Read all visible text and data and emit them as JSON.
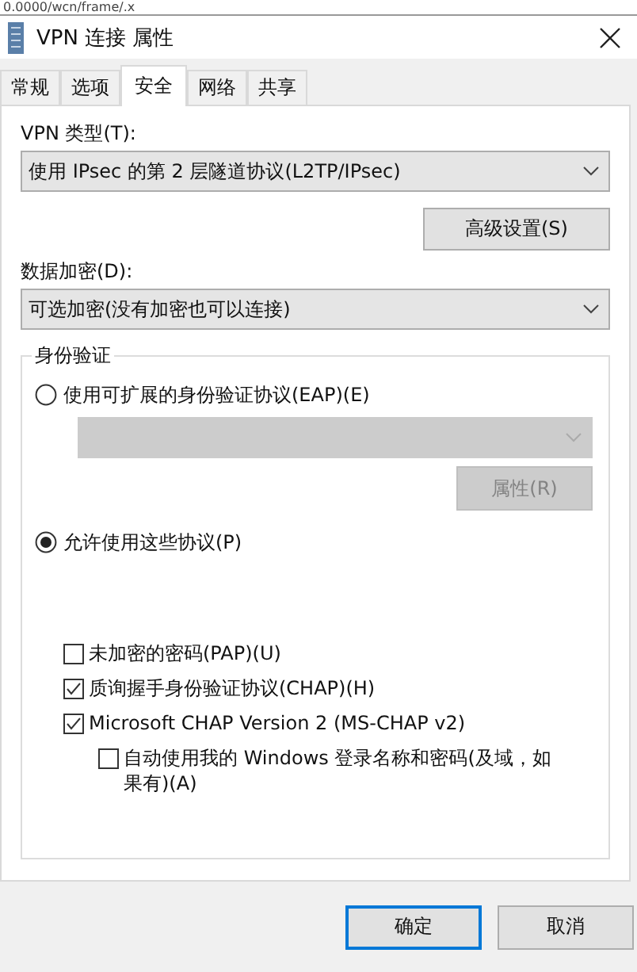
{
  "background_window": {
    "address": "0.0000/wcn/frame/.x"
  },
  "window": {
    "title": "VPN 连接 属性"
  },
  "tabs": [
    {
      "label": "常规",
      "selected": false
    },
    {
      "label": "选项",
      "selected": false
    },
    {
      "label": "安全",
      "selected": true
    },
    {
      "label": "网络",
      "selected": false
    },
    {
      "label": "共享",
      "selected": false
    }
  ],
  "vpn_type": {
    "label": "VPN 类型(T):",
    "value": "使用 IPsec 的第 2 层隧道协议(L2TP/IPsec)"
  },
  "advanced_button": {
    "label": "高级设置(S)"
  },
  "encryption": {
    "label": "数据加密(D):",
    "value": "可选加密(没有加密也可以连接)"
  },
  "authentication": {
    "title": "身份验证",
    "methods": [
      {
        "label": "使用可扩展的身份验证协议(EAP)(E)",
        "selected": false,
        "dropdown": {
          "disabled": true
        },
        "properties_button": {
          "label": "属性(R)",
          "disabled": true
        }
      },
      {
        "label": "允许使用这些协议(P)",
        "selected": true
      }
    ],
    "protocols": [
      {
        "label": "未加密的密码(PAP)(U)",
        "checked": false
      },
      {
        "label": "质询握手身份验证协议(CHAP)(H)",
        "checked": true
      },
      {
        "label": "Microsoft CHAP Version 2 (MS-CHAP v2)",
        "checked": true,
        "children": [
          {
            "label": "自动使用我的 Windows 登录名称和密码(及域，如果有)(A)",
            "checked": false
          }
        ]
      }
    ]
  },
  "buttons": [
    {
      "label": "确定",
      "default": true
    },
    {
      "label": "取消",
      "default": false
    }
  ]
}
